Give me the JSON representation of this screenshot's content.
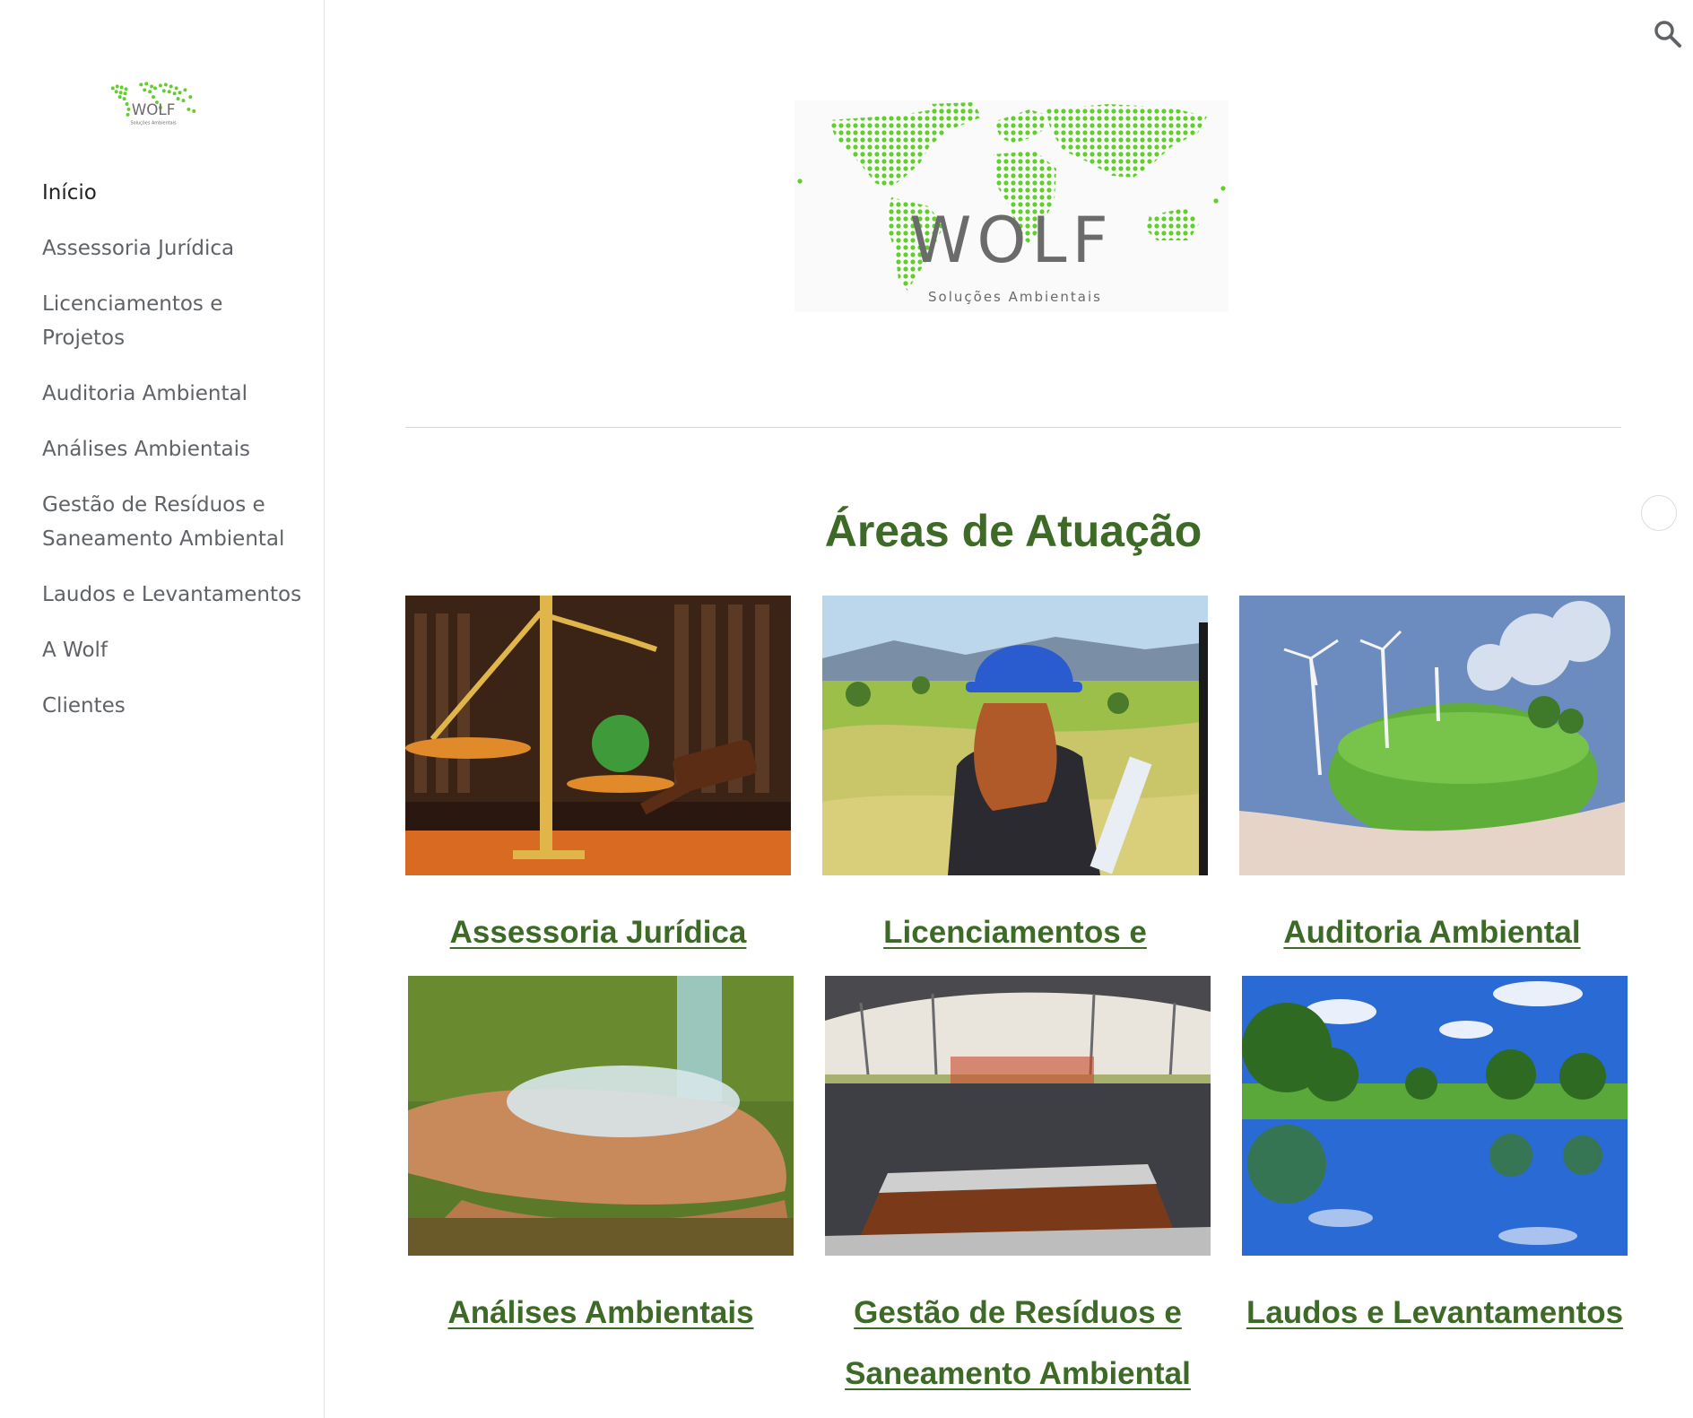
{
  "brand": {
    "logo_word": "WOLF",
    "logo_tagline": "Soluções Ambientais"
  },
  "sidebar": {
    "items": [
      {
        "label": "Início",
        "active": true
      },
      {
        "label": "Assessoria Jurídica",
        "active": false
      },
      {
        "label": "Licenciamentos e Projetos",
        "active": false
      },
      {
        "label": "Auditoria Ambiental",
        "active": false
      },
      {
        "label": "Análises Ambientais",
        "active": false
      },
      {
        "label": "Gestão de Resíduos e Saneamento Ambiental",
        "active": false
      },
      {
        "label": "Laudos e Levantamentos",
        "active": false
      },
      {
        "label": "A Wolf",
        "active": false
      },
      {
        "label": "Clientes",
        "active": false
      }
    ]
  },
  "header": {
    "search_icon": "search-icon"
  },
  "main": {
    "section_title": "Áreas de Atuação",
    "cards": [
      {
        "title": "Assessoria Jurídica",
        "image": "scales-of-justice-photo"
      },
      {
        "title": "Licenciamentos e Projetos",
        "image": "engineer-hardhat-photo"
      },
      {
        "title": "Auditoria Ambiental",
        "image": "green-globe-hand-photo"
      },
      {
        "title": "Análises Ambientais",
        "image": "water-hands-photo"
      },
      {
        "title": "Gestão de Resíduos e Saneamento Ambiental",
        "image": "lined-pond-photo"
      },
      {
        "title": "Laudos e Levantamentos",
        "image": "lake-trees-photo"
      }
    ]
  },
  "colors": {
    "accent": "#3d6a27",
    "logo_green": "#5fcf2a",
    "logo_gray": "#6b6b6b",
    "nav_text": "#5f6368",
    "nav_active": "#212121"
  }
}
